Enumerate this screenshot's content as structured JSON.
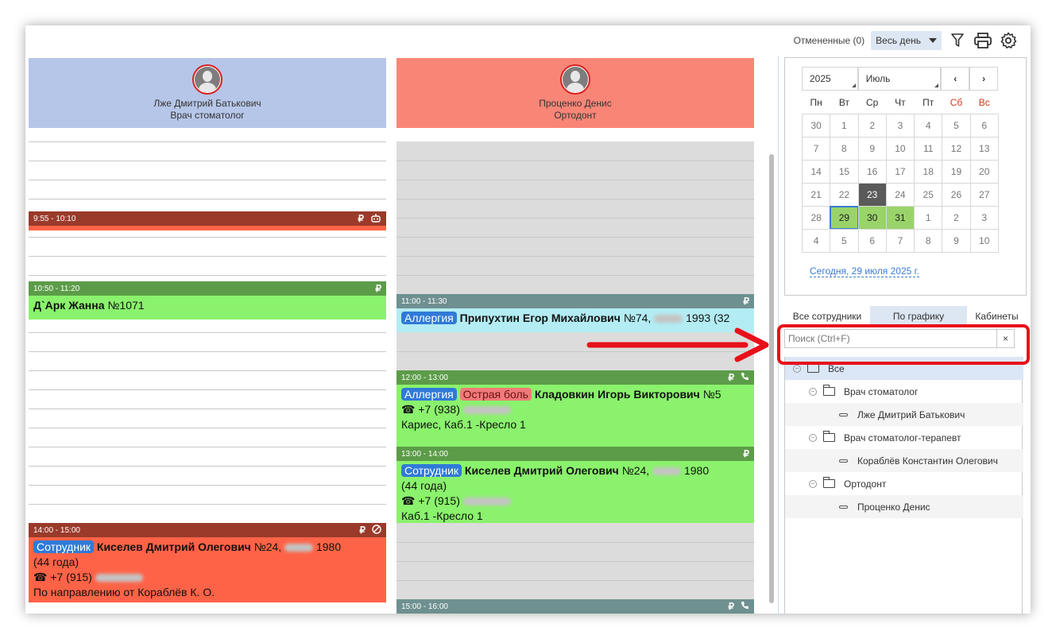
{
  "toolbar": {
    "cancelled_label": "Отмененные (0)",
    "period_select": "Весь день",
    "icons": [
      "filter-icon",
      "print-icon",
      "settings-icon"
    ]
  },
  "columns": [
    {
      "doctor_name": "Лже Дмитрий Батькович",
      "specialty": "Врач стоматолог",
      "header_color": "#b6c6e8",
      "appointments": [
        {
          "time": "9:55 - 10:10",
          "bar_color": "#9a3a2a",
          "icons": [
            "₽",
            "robot-icon"
          ]
        },
        {
          "time": "10:50 - 11:20",
          "bar_color": "#5c9c48",
          "body_color": "#8af26c",
          "icons": [
            "₽"
          ],
          "patient": "Д`Арк Жанна",
          "number": "№1071"
        },
        {
          "time": "14:00 - 15:00",
          "bar_color": "#9a3a2a",
          "body_color": "#ff6347",
          "icons": [
            "₽",
            "cancel-icon"
          ],
          "tags": [
            "Сотрудник"
          ],
          "patient": "Киселев Дмитрий Олегович",
          "number": "№24,",
          "year": "1980",
          "age": "(44 года)",
          "phone": "+7 (915)",
          "note": "По направлению от Кораблёв К. О."
        }
      ]
    },
    {
      "doctor_name": "Проценко Денис",
      "specialty": "Ортодонт",
      "header_color": "#f98577",
      "appointments": [
        {
          "time": "11:00 - 11:30",
          "bar_color": "#6f9090",
          "body_color": "#b3ecf3",
          "icons": [
            "₽"
          ],
          "tags": [
            "Аллергия"
          ],
          "patient": "Припухтин Егор Михайлович",
          "number": "№74,",
          "year": "1993 (32"
        },
        {
          "time": "12:00 - 13:00",
          "bar_color": "#5c9c48",
          "body_color": "#8af26c",
          "icons": [
            "₽",
            "phone-icon"
          ],
          "tags": [
            "Аллергия",
            "Острая боль"
          ],
          "patient": "Кладовкин Игорь Викторович",
          "number": "№5",
          "phone": "+7 (938)",
          "note": "Кариес, Каб.1 -Кресло 1"
        },
        {
          "time": "13:00 - 14:00",
          "bar_color": "#5c9c48",
          "body_color": "#8af26c",
          "icons": [
            "₽"
          ],
          "tags": [
            "Сотрудник"
          ],
          "patient": "Киселев Дмитрий Олегович",
          "number": "№24,",
          "year": "1980",
          "age": "(44 года)",
          "phone": "+7 (915)",
          "note": "Каб.1 -Кресло 1"
        },
        {
          "time": "15:00 - 16:00",
          "bar_color": "#6f9090",
          "icons": [
            "₽",
            "phone-icon"
          ]
        }
      ]
    }
  ],
  "calendar": {
    "year": "2025",
    "month": "Июль",
    "prev": "‹",
    "next": "›",
    "weekdays": [
      "Пн",
      "Вт",
      "Ср",
      "Чт",
      "Пт",
      "Сб",
      "Вс"
    ],
    "weeks": [
      [
        "30",
        "1",
        "2",
        "3",
        "4",
        "5",
        "6"
      ],
      [
        "7",
        "8",
        "9",
        "10",
        "11",
        "12",
        "13"
      ],
      [
        "14",
        "15",
        "16",
        "17",
        "18",
        "19",
        "20"
      ],
      [
        "21",
        "22",
        "23",
        "24",
        "25",
        "26",
        "27"
      ],
      [
        "28",
        "29",
        "30",
        "31",
        "1",
        "2",
        "3"
      ],
      [
        "4",
        "5",
        "6",
        "7",
        "8",
        "9",
        "10"
      ]
    ],
    "today_link": "Сегодня, 29 июля 2025 г."
  },
  "tabs": [
    "Все сотрудники",
    "По графику",
    "Кабинеты"
  ],
  "search": {
    "placeholder": "Поиск (Ctrl+F)",
    "clear": "×"
  },
  "tree": [
    {
      "label": "Все",
      "type": "folder",
      "level": 0
    },
    {
      "label": "Врач стоматолог",
      "type": "folder",
      "level": 1
    },
    {
      "label": "Лже Дмитрий Батькович",
      "type": "leaf",
      "level": 2
    },
    {
      "label": "Врач стоматолог-терапевт",
      "type": "folder",
      "level": 1
    },
    {
      "label": "Кораблёв Константин Олегович",
      "type": "leaf",
      "level": 2
    },
    {
      "label": "Ортодонт",
      "type": "folder",
      "level": 1
    },
    {
      "label": "Проценко Денис",
      "type": "leaf",
      "level": 2
    }
  ],
  "colors": {
    "accent": "#3a7bd5",
    "highlight": "#e8101a"
  }
}
